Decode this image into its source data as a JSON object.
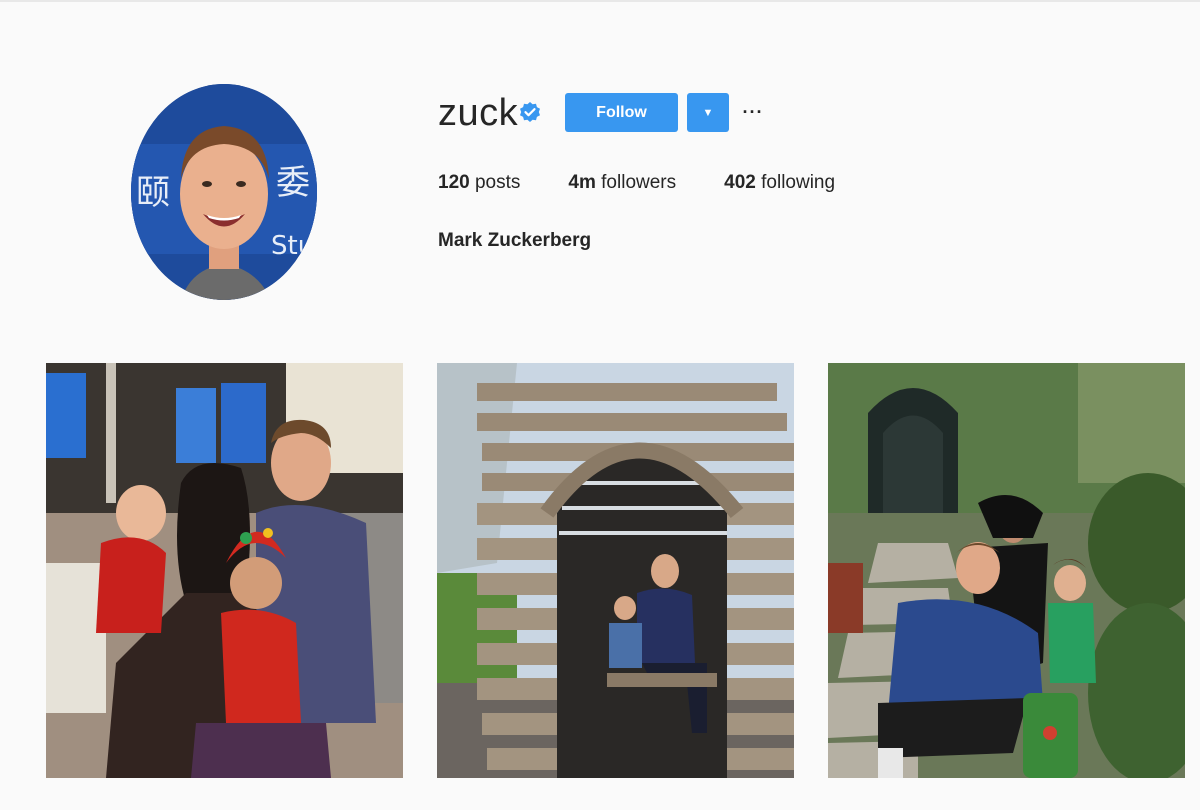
{
  "profile": {
    "username": "zuck",
    "follow_label": "Follow",
    "more_label": "···",
    "dropdown_label": "▼",
    "full_name": "Mark Zuckerberg",
    "stats": {
      "posts_count": "120",
      "posts_label": "posts",
      "followers_count": "4m",
      "followers_label": "followers",
      "following_count": "402",
      "following_label": "following"
    }
  },
  "colors": {
    "accent": "#3897f0",
    "verified": "#3897f0",
    "background": "#fafafa"
  },
  "icons": {
    "verified": "verified-badge-icon",
    "dropdown": "chevron-down-icon",
    "more": "more-options-icon"
  },
  "posts": [
    {
      "description": "family photo on couch"
    },
    {
      "description": "wooden arch structure"
    },
    {
      "description": "garden with child"
    }
  ]
}
